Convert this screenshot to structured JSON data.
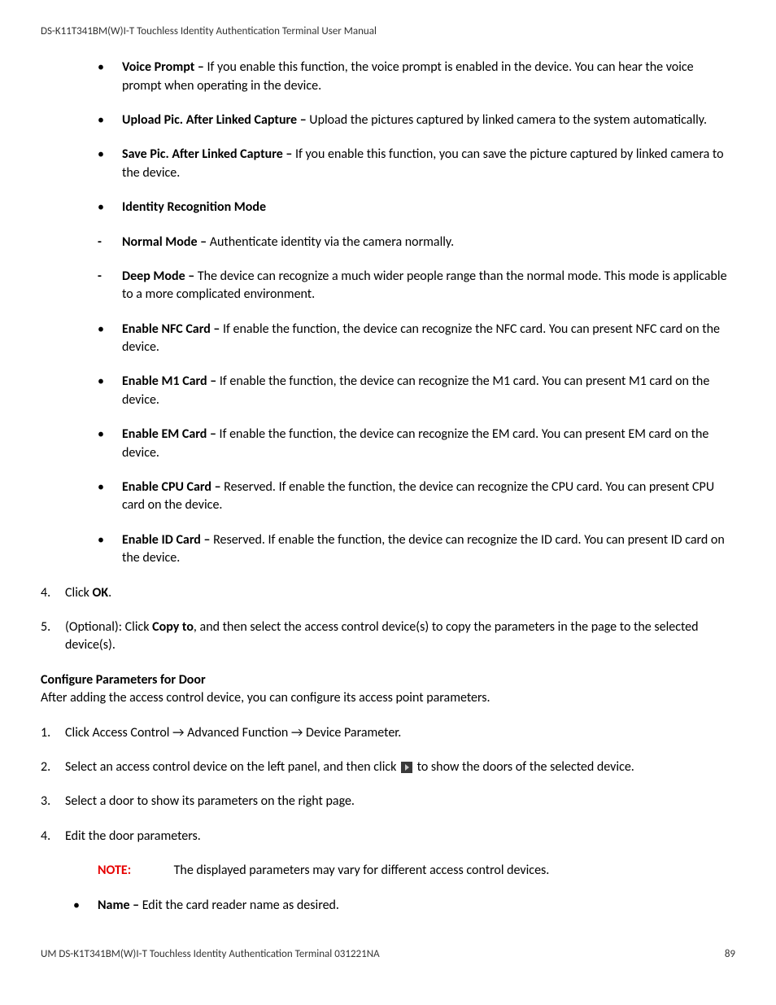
{
  "header": "DS-K11T341BM(W)I-T Touchless Identity Authentication Terminal User Manual",
  "bullets1": [
    {
      "label": "Voice Prompt – ",
      "text": "If you enable this function, the voice prompt is enabled in the device. You can hear the voice prompt when operating in the device."
    },
    {
      "label": "Upload Pic. After Linked Capture – ",
      "text": "Upload the pictures captured by linked camera to the system automatically."
    },
    {
      "label": "Save Pic. After Linked Capture – ",
      "text": "If you enable this function, you can save the picture captured by linked camera to the device."
    },
    {
      "label": "Identity Recognition Mode",
      "text": ""
    }
  ],
  "dashes": [
    {
      "label": "Normal Mode – ",
      "text": "Authenticate identity via the camera normally."
    },
    {
      "label": "Deep Mode – ",
      "text": "The device can recognize a much wider people range than the normal mode. This mode is applicable to a more complicated environment."
    }
  ],
  "bullets2": [
    {
      "label": "Enable NFC Card – ",
      "text": "If enable the function, the device can recognize the NFC card. You can present NFC card on the device."
    },
    {
      "label": "Enable M1 Card – ",
      "text": "If enable the function, the device can recognize the M1 card. You can present M1 card on the device."
    },
    {
      "label": "Enable EM Card – ",
      "text": "If enable the function, the device can recognize the EM card. You can present EM card on the device."
    },
    {
      "label": "Enable CPU Card – ",
      "text": "Reserved. If enable the function, the device can recognize the CPU card. You can present CPU card on the device."
    },
    {
      "label": "Enable ID Card – ",
      "text": "Reserved. If enable the function, the device can recognize the ID card. You can present ID card on the device."
    }
  ],
  "step4": {
    "num": "4.",
    "pre": "Click ",
    "bold": "OK",
    "post": "."
  },
  "step5": {
    "num": "5.",
    "pre": "(Optional): Click ",
    "bold": "Copy to",
    "post": ", and then select the access control device(s) to copy the parameters in the page to the selected device(s)."
  },
  "section2_title": "Configure Parameters for Door",
  "section2_intro": "After adding the access control device, you can configure its access point parameters.",
  "steps2": {
    "s1": {
      "num": "1.",
      "text": "Click Access Control → Advanced Function → Device Parameter."
    },
    "s2": {
      "num": "2.",
      "pre": "Select an access control device on the left panel, and then click ",
      "post": " to show the doors of the selected device."
    },
    "s3": {
      "num": "3.",
      "text": "Select a door to show its parameters on the right page."
    },
    "s4": {
      "num": "4.",
      "text": "Edit the door parameters."
    }
  },
  "note": {
    "label": "NOTE:",
    "text": "The displayed parameters may vary for different access control devices."
  },
  "inner_bullet": {
    "label": "Name – ",
    "text": "Edit the card reader name as desired."
  },
  "footer_left": "UM DS-K1T341BM(W)I-T Touchless Identity Authentication Terminal 031221NA",
  "footer_right": "89"
}
